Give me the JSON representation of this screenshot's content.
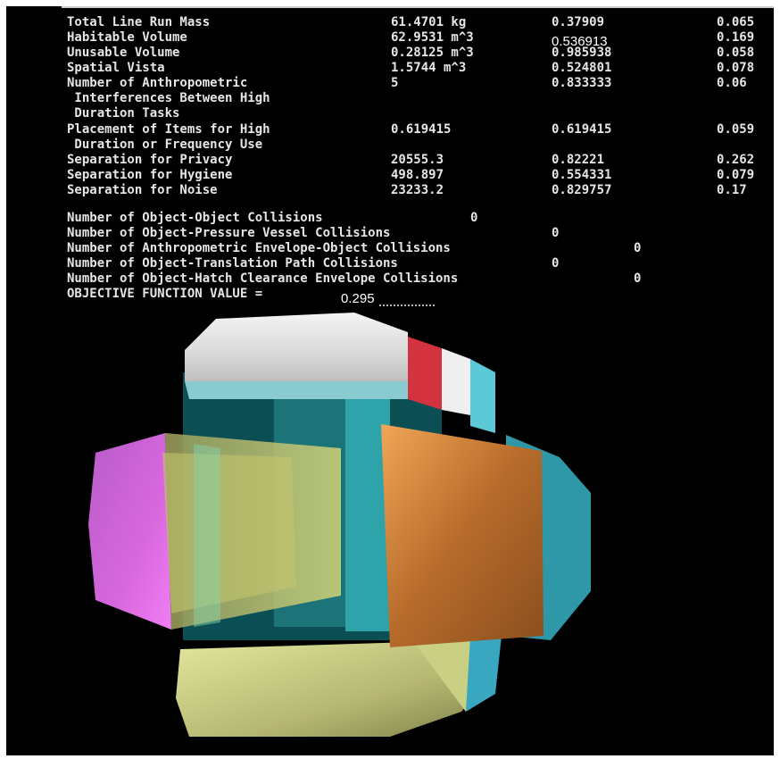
{
  "metrics": [
    {
      "name": "Total Line Run Mass",
      "value": "61.4701 kg",
      "score": "0.37909",
      "weight": "0.065"
    },
    {
      "name": "Habitable Volume",
      "value": "62.9531 m^3",
      "score": "0.536913",
      "weight": "0.169"
    },
    {
      "name": "Unusable Volume",
      "value": "0.28125 m^3",
      "score": "0.985938",
      "weight": "0.058"
    },
    {
      "name": "Spatial Vista",
      "value": "1.5744 m^3",
      "score": "0.524801",
      "weight": "0.078"
    },
    {
      "name": "Number of Anthropometric\n Interferences Between High\n Duration Tasks",
      "value": "5",
      "score": "0.833333",
      "weight": "0.06"
    },
    {
      "name": "Placement of Items for High\n Duration or Frequency Use",
      "value": "0.619415",
      "score": "0.619415",
      "weight": "0.059"
    },
    {
      "name": "Separation for Privacy",
      "value": "20555.3",
      "score": "0.82221",
      "weight": "0.262"
    },
    {
      "name": "Separation for Hygiene",
      "value": "498.897",
      "score": "0.554331",
      "weight": "0.079"
    },
    {
      "name": "Separation for Noise",
      "value": "23233.2",
      "score": "0.829757",
      "weight": "0.17"
    }
  ],
  "collisions": [
    {
      "label": "Number of Object-Object Collisions",
      "value": "0"
    },
    {
      "label": "Number of Object-Pressure Vessel Collisions",
      "value": "0"
    },
    {
      "label": "Number of Anthropometric Envelope-Object Collisions",
      "value": "0"
    },
    {
      "label": "Number of Object-Translation Path Collisions",
      "value": "0"
    },
    {
      "label": "Number of Object-Hatch Clearance Envelope Collisions",
      "value": "0"
    }
  ],
  "objective_label": "OBJECTIVE FUNCTION VALUE = ",
  "objective_value": "0.295"
}
